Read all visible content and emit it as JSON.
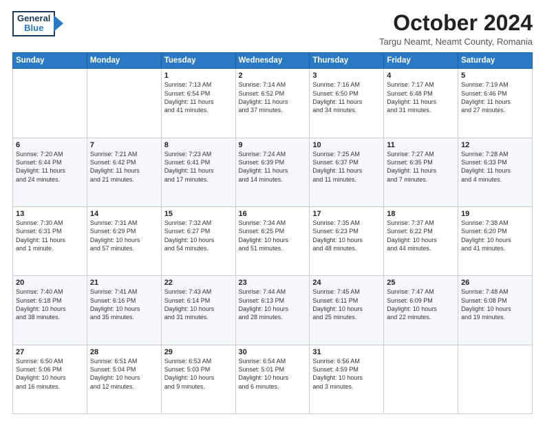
{
  "header": {
    "logo_general": "General",
    "logo_blue": "Blue",
    "month_title": "October 2024",
    "subtitle": "Targu Neamt, Neamt County, Romania"
  },
  "weekdays": [
    "Sunday",
    "Monday",
    "Tuesday",
    "Wednesday",
    "Thursday",
    "Friday",
    "Saturday"
  ],
  "weeks": [
    [
      {
        "day": "",
        "lines": []
      },
      {
        "day": "",
        "lines": []
      },
      {
        "day": "1",
        "lines": [
          "Sunrise: 7:13 AM",
          "Sunset: 6:54 PM",
          "Daylight: 11 hours",
          "and 41 minutes."
        ]
      },
      {
        "day": "2",
        "lines": [
          "Sunrise: 7:14 AM",
          "Sunset: 6:52 PM",
          "Daylight: 11 hours",
          "and 37 minutes."
        ]
      },
      {
        "day": "3",
        "lines": [
          "Sunrise: 7:16 AM",
          "Sunset: 6:50 PM",
          "Daylight: 11 hours",
          "and 34 minutes."
        ]
      },
      {
        "day": "4",
        "lines": [
          "Sunrise: 7:17 AM",
          "Sunset: 6:48 PM",
          "Daylight: 11 hours",
          "and 31 minutes."
        ]
      },
      {
        "day": "5",
        "lines": [
          "Sunrise: 7:19 AM",
          "Sunset: 6:46 PM",
          "Daylight: 11 hours",
          "and 27 minutes."
        ]
      }
    ],
    [
      {
        "day": "6",
        "lines": [
          "Sunrise: 7:20 AM",
          "Sunset: 6:44 PM",
          "Daylight: 11 hours",
          "and 24 minutes."
        ]
      },
      {
        "day": "7",
        "lines": [
          "Sunrise: 7:21 AM",
          "Sunset: 6:42 PM",
          "Daylight: 11 hours",
          "and 21 minutes."
        ]
      },
      {
        "day": "8",
        "lines": [
          "Sunrise: 7:23 AM",
          "Sunset: 6:41 PM",
          "Daylight: 11 hours",
          "and 17 minutes."
        ]
      },
      {
        "day": "9",
        "lines": [
          "Sunrise: 7:24 AM",
          "Sunset: 6:39 PM",
          "Daylight: 11 hours",
          "and 14 minutes."
        ]
      },
      {
        "day": "10",
        "lines": [
          "Sunrise: 7:25 AM",
          "Sunset: 6:37 PM",
          "Daylight: 11 hours",
          "and 11 minutes."
        ]
      },
      {
        "day": "11",
        "lines": [
          "Sunrise: 7:27 AM",
          "Sunset: 6:35 PM",
          "Daylight: 11 hours",
          "and 7 minutes."
        ]
      },
      {
        "day": "12",
        "lines": [
          "Sunrise: 7:28 AM",
          "Sunset: 6:33 PM",
          "Daylight: 11 hours",
          "and 4 minutes."
        ]
      }
    ],
    [
      {
        "day": "13",
        "lines": [
          "Sunrise: 7:30 AM",
          "Sunset: 6:31 PM",
          "Daylight: 11 hours",
          "and 1 minute."
        ]
      },
      {
        "day": "14",
        "lines": [
          "Sunrise: 7:31 AM",
          "Sunset: 6:29 PM",
          "Daylight: 10 hours",
          "and 57 minutes."
        ]
      },
      {
        "day": "15",
        "lines": [
          "Sunrise: 7:32 AM",
          "Sunset: 6:27 PM",
          "Daylight: 10 hours",
          "and 54 minutes."
        ]
      },
      {
        "day": "16",
        "lines": [
          "Sunrise: 7:34 AM",
          "Sunset: 6:25 PM",
          "Daylight: 10 hours",
          "and 51 minutes."
        ]
      },
      {
        "day": "17",
        "lines": [
          "Sunrise: 7:35 AM",
          "Sunset: 6:23 PM",
          "Daylight: 10 hours",
          "and 48 minutes."
        ]
      },
      {
        "day": "18",
        "lines": [
          "Sunrise: 7:37 AM",
          "Sunset: 6:22 PM",
          "Daylight: 10 hours",
          "and 44 minutes."
        ]
      },
      {
        "day": "19",
        "lines": [
          "Sunrise: 7:38 AM",
          "Sunset: 6:20 PM",
          "Daylight: 10 hours",
          "and 41 minutes."
        ]
      }
    ],
    [
      {
        "day": "20",
        "lines": [
          "Sunrise: 7:40 AM",
          "Sunset: 6:18 PM",
          "Daylight: 10 hours",
          "and 38 minutes."
        ]
      },
      {
        "day": "21",
        "lines": [
          "Sunrise: 7:41 AM",
          "Sunset: 6:16 PM",
          "Daylight: 10 hours",
          "and 35 minutes."
        ]
      },
      {
        "day": "22",
        "lines": [
          "Sunrise: 7:43 AM",
          "Sunset: 6:14 PM",
          "Daylight: 10 hours",
          "and 31 minutes."
        ]
      },
      {
        "day": "23",
        "lines": [
          "Sunrise: 7:44 AM",
          "Sunset: 6:13 PM",
          "Daylight: 10 hours",
          "and 28 minutes."
        ]
      },
      {
        "day": "24",
        "lines": [
          "Sunrise: 7:45 AM",
          "Sunset: 6:11 PM",
          "Daylight: 10 hours",
          "and 25 minutes."
        ]
      },
      {
        "day": "25",
        "lines": [
          "Sunrise: 7:47 AM",
          "Sunset: 6:09 PM",
          "Daylight: 10 hours",
          "and 22 minutes."
        ]
      },
      {
        "day": "26",
        "lines": [
          "Sunrise: 7:48 AM",
          "Sunset: 6:08 PM",
          "Daylight: 10 hours",
          "and 19 minutes."
        ]
      }
    ],
    [
      {
        "day": "27",
        "lines": [
          "Sunrise: 6:50 AM",
          "Sunset: 5:06 PM",
          "Daylight: 10 hours",
          "and 16 minutes."
        ]
      },
      {
        "day": "28",
        "lines": [
          "Sunrise: 6:51 AM",
          "Sunset: 5:04 PM",
          "Daylight: 10 hours",
          "and 12 minutes."
        ]
      },
      {
        "day": "29",
        "lines": [
          "Sunrise: 6:53 AM",
          "Sunset: 5:03 PM",
          "Daylight: 10 hours",
          "and 9 minutes."
        ]
      },
      {
        "day": "30",
        "lines": [
          "Sunrise: 6:54 AM",
          "Sunset: 5:01 PM",
          "Daylight: 10 hours",
          "and 6 minutes."
        ]
      },
      {
        "day": "31",
        "lines": [
          "Sunrise: 6:56 AM",
          "Sunset: 4:59 PM",
          "Daylight: 10 hours",
          "and 3 minutes."
        ]
      },
      {
        "day": "",
        "lines": []
      },
      {
        "day": "",
        "lines": []
      }
    ]
  ]
}
